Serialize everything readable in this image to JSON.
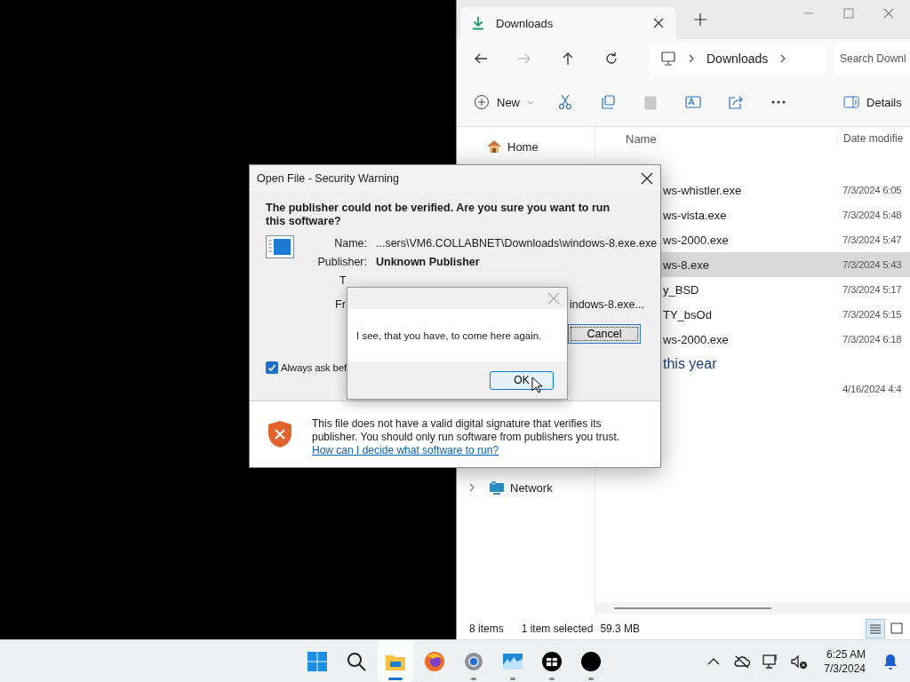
{
  "explorer": {
    "tab": {
      "title": "Downloads"
    },
    "nav": [
      {
        "kind": "back",
        "disabled": false
      },
      {
        "kind": "forward",
        "disabled": true
      },
      {
        "kind": "up",
        "disabled": false
      },
      {
        "kind": "refresh",
        "disabled": false
      }
    ],
    "breadcrumb": [
      "Downloads"
    ],
    "search": {
      "placeholder": "Search Downl"
    },
    "toolbar": [
      {
        "kind": "new",
        "label": "New",
        "disabled": false
      },
      {
        "kind": "cut",
        "disabled": false
      },
      {
        "kind": "copy",
        "disabled": false
      },
      {
        "kind": "paste",
        "disabled": true
      },
      {
        "kind": "rename",
        "disabled": false
      },
      {
        "kind": "share",
        "disabled": false
      },
      {
        "kind": "more",
        "disabled": false
      },
      {
        "kind": "details",
        "label": "Details",
        "disabled": false
      }
    ],
    "sidebar": [
      {
        "kind": "home",
        "label": "Home"
      },
      {
        "kind": "network",
        "label": "Network"
      }
    ],
    "columns": [
      "Name",
      "Date modifie"
    ],
    "rows": [
      {
        "kind": "file",
        "name": "ws-whistler.exe",
        "date": "7/3/2024 6:05",
        "selected": false
      },
      {
        "kind": "file",
        "name": "ws-vista.exe",
        "date": "7/3/2024 5:48",
        "selected": false
      },
      {
        "kind": "file",
        "name": "ws-2000.exe",
        "date": "7/3/2024 5:47",
        "selected": false
      },
      {
        "kind": "file",
        "name": "ws-8.exe",
        "date": "7/3/2024 5:43",
        "selected": true
      },
      {
        "kind": "file",
        "name": "y_BSD",
        "date": "7/3/2024 5:17",
        "selected": false
      },
      {
        "kind": "file",
        "name": "TY_bsOd",
        "date": "7/3/2024 5:15",
        "selected": false
      },
      {
        "kind": "file",
        "name": "ws-2000.exe",
        "date": "7/3/2024 6:18",
        "selected": false
      },
      {
        "kind": "group",
        "name": "this year"
      },
      {
        "kind": "file",
        "date": "4/16/2024 4:4",
        "selected": false
      }
    ],
    "status": {
      "count": "8 items",
      "selection": "1 item selected",
      "size": "59.3 MB"
    },
    "views": [
      {
        "kind": "details",
        "selected": true
      },
      {
        "kind": "tiles",
        "selected": false
      }
    ]
  },
  "security_dialog": {
    "title": "Open File - Security Warning",
    "heading": "The publisher could not be verified.  Are you sure you want to run this software?",
    "fields": [
      {
        "label": "Name:",
        "value": "...sers\\VM6.COLLABNET\\Downloads\\windows-8.exe.exe",
        "bold": false
      },
      {
        "label": "Publisher:",
        "value": "Unknown Publisher",
        "bold": true
      },
      {
        "label": "T"
      },
      {
        "label": "Fr",
        "value": "indows-8.exe...",
        "bold": false
      }
    ],
    "cancel_button": "Cancel",
    "checkbox": {
      "label": "Always ask bef",
      "checked": true
    },
    "footer_text": "This file does not have a valid digital signature that verifies its publisher.  You should only run software from publishers you trust.",
    "help_link": "How can I decide what software to run?"
  },
  "message_box": {
    "message": "I see, that you have, to come here again.",
    "button": "OK"
  },
  "taskbar": {
    "apps": [
      {
        "kind": "start",
        "running": false,
        "selected": false
      },
      {
        "kind": "search",
        "running": false,
        "selected": false
      },
      {
        "kind": "explorer",
        "running": true,
        "selected": true
      },
      {
        "kind": "firefox",
        "running": false,
        "selected": false
      },
      {
        "kind": "settings",
        "running": true,
        "selected": false
      },
      {
        "kind": "photo",
        "running": true,
        "selected": false
      },
      {
        "kind": "face",
        "running": true,
        "selected": false
      },
      {
        "kind": "circle",
        "running": true,
        "selected": false
      }
    ],
    "tray": [
      {
        "kind": "chevron"
      },
      {
        "kind": "cloud"
      },
      {
        "kind": "network"
      },
      {
        "kind": "sound"
      }
    ],
    "clock": {
      "time": "6:25 AM",
      "date": "7/3/2024"
    }
  }
}
